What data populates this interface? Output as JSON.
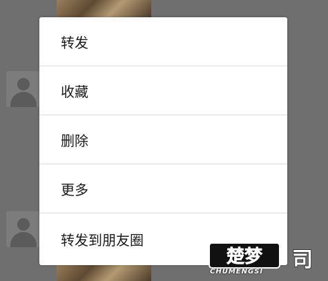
{
  "menu": {
    "items": [
      {
        "label": "转发"
      },
      {
        "label": "收藏"
      },
      {
        "label": "删除"
      },
      {
        "label": "更多"
      },
      {
        "label": "转发到朋友圈"
      }
    ]
  },
  "watermark": {
    "logo_text": "楚梦",
    "brand_text": "CHUMENGSI",
    "extra_char": "司"
  },
  "colors": {
    "overlay": "#6f6f6f",
    "menu_background": "#ffffff",
    "divider": "#dcdcdc",
    "text": "#1a1a1a"
  }
}
